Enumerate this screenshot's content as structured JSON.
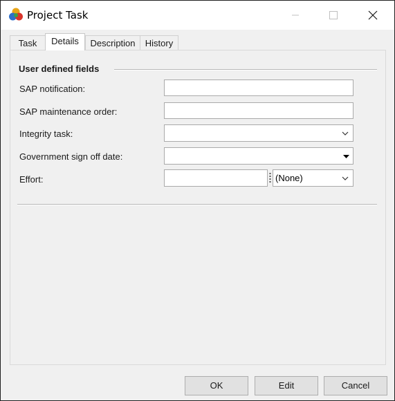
{
  "window": {
    "title": "Project Task",
    "controls": [
      "minimize-icon",
      "maximize-icon",
      "close-icon"
    ]
  },
  "tabs": [
    {
      "label": "Task",
      "active": false
    },
    {
      "label": "Details",
      "active": true
    },
    {
      "label": "Description",
      "active": false
    },
    {
      "label": "History",
      "active": false
    }
  ],
  "details": {
    "group_title": "User defined fields",
    "fields": [
      {
        "label": "SAP notification:",
        "value": ""
      },
      {
        "label": "SAP maintenance order:",
        "value": ""
      },
      {
        "label": "Integrity task:",
        "value": ""
      },
      {
        "label": "Government sign off date:",
        "value": ""
      },
      {
        "label": "Effort:",
        "value": "",
        "unit": "(None)"
      }
    ]
  },
  "buttons": {
    "ok": "OK",
    "edit": "Edit",
    "cancel": "Cancel"
  }
}
